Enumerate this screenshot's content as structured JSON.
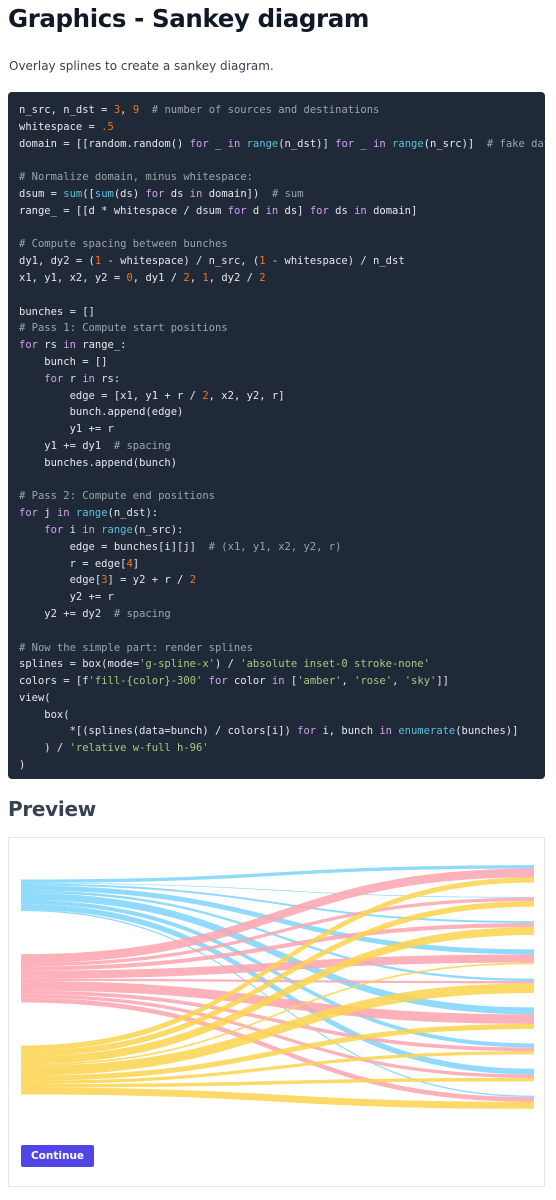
{
  "page": {
    "title": "Graphics - Sankey diagram",
    "subtitle": "Overlay splines to create a sankey diagram."
  },
  "code": {
    "lines": [
      [
        [
          "",
          "n_src, n_dst = "
        ],
        [
          "num",
          "3"
        ],
        [
          "",
          ", "
        ],
        [
          "num",
          "9"
        ],
        [
          "",
          "  "
        ],
        [
          "com",
          "# number of sources and destinations"
        ]
      ],
      [
        [
          "",
          "whitespace = "
        ],
        [
          "num",
          ".5"
        ]
      ],
      [
        [
          "",
          "domain = [[random.random() "
        ],
        [
          "kw",
          "for"
        ],
        [
          "",
          " _ "
        ],
        [
          "kw",
          "in"
        ],
        [
          "",
          " "
        ],
        [
          "fn",
          "range"
        ],
        [
          "",
          "(n_dst)] "
        ],
        [
          "kw",
          "for"
        ],
        [
          "",
          " _ "
        ],
        [
          "kw",
          "in"
        ],
        [
          "",
          " "
        ],
        [
          "fn",
          "range"
        ],
        [
          "",
          "(n_src)]  "
        ],
        [
          "com",
          "# fake data"
        ]
      ],
      [],
      [
        [
          "com",
          "# Normalize domain, minus whitespace:"
        ]
      ],
      [
        [
          "",
          "dsum = "
        ],
        [
          "fn",
          "sum"
        ],
        [
          "",
          "(["
        ],
        [
          "fn",
          "sum"
        ],
        [
          "",
          "(ds) "
        ],
        [
          "kw",
          "for"
        ],
        [
          "",
          " ds "
        ],
        [
          "kw",
          "in"
        ],
        [
          "",
          " domain])  "
        ],
        [
          "com",
          "# sum"
        ]
      ],
      [
        [
          "",
          "range_ = [[d * whitespace / dsum "
        ],
        [
          "kw",
          "for"
        ],
        [
          "",
          " d "
        ],
        [
          "kw",
          "in"
        ],
        [
          "",
          " ds] "
        ],
        [
          "kw",
          "for"
        ],
        [
          "",
          " ds "
        ],
        [
          "kw",
          "in"
        ],
        [
          "",
          " domain]"
        ]
      ],
      [],
      [
        [
          "com",
          "# Compute spacing between bunches"
        ]
      ],
      [
        [
          "",
          "dy1, dy2 = ("
        ],
        [
          "num",
          "1"
        ],
        [
          "",
          " - whitespace) / n_src, ("
        ],
        [
          "num",
          "1"
        ],
        [
          "",
          " - whitespace) / n_dst"
        ]
      ],
      [
        [
          "",
          "x1, y1, x2, y2 = "
        ],
        [
          "num",
          "0"
        ],
        [
          "",
          ", dy1 / "
        ],
        [
          "num",
          "2"
        ],
        [
          "",
          ", "
        ],
        [
          "num",
          "1"
        ],
        [
          "",
          ", dy2 / "
        ],
        [
          "num",
          "2"
        ]
      ],
      [],
      [
        [
          "",
          "bunches = []"
        ]
      ],
      [
        [
          "com",
          "# Pass 1: Compute start positions"
        ]
      ],
      [
        [
          "kw",
          "for"
        ],
        [
          "",
          " rs "
        ],
        [
          "kw",
          "in"
        ],
        [
          "",
          " range_:"
        ]
      ],
      [
        [
          "",
          "    bunch = []"
        ]
      ],
      [
        [
          "",
          "    "
        ],
        [
          "kw",
          "for"
        ],
        [
          "",
          " r "
        ],
        [
          "kw",
          "in"
        ],
        [
          "",
          " rs:"
        ]
      ],
      [
        [
          "",
          "        edge = [x1, y1 + r / "
        ],
        [
          "num",
          "2"
        ],
        [
          "",
          ", x2, y2, r]"
        ]
      ],
      [
        [
          "",
          "        bunch.append(edge)"
        ]
      ],
      [
        [
          "",
          "        y1 += r"
        ]
      ],
      [
        [
          "",
          "    y1 += dy1  "
        ],
        [
          "com",
          "# spacing"
        ]
      ],
      [
        [
          "",
          "    bunches.append(bunch)"
        ]
      ],
      [],
      [
        [
          "com",
          "# Pass 2: Compute end positions"
        ]
      ],
      [
        [
          "kw",
          "for"
        ],
        [
          "",
          " j "
        ],
        [
          "kw",
          "in"
        ],
        [
          "",
          " "
        ],
        [
          "fn",
          "range"
        ],
        [
          "",
          "(n_dst):"
        ]
      ],
      [
        [
          "",
          "    "
        ],
        [
          "kw",
          "for"
        ],
        [
          "",
          " i "
        ],
        [
          "kw",
          "in"
        ],
        [
          "",
          " "
        ],
        [
          "fn",
          "range"
        ],
        [
          "",
          "(n_src):"
        ]
      ],
      [
        [
          "",
          "        edge = bunches[i][j]  "
        ],
        [
          "com",
          "# (x1, y1, x2, y2, r)"
        ]
      ],
      [
        [
          "",
          "        r = edge["
        ],
        [
          "num",
          "4"
        ],
        [
          "",
          "]"
        ]
      ],
      [
        [
          "",
          "        edge["
        ],
        [
          "num",
          "3"
        ],
        [
          "",
          "] = y2 + r / "
        ],
        [
          "num",
          "2"
        ]
      ],
      [
        [
          "",
          "        y2 += r"
        ]
      ],
      [
        [
          "",
          "    y2 += dy2  "
        ],
        [
          "com",
          "# spacing"
        ]
      ],
      [],
      [
        [
          "com",
          "# Now the simple part: render splines"
        ]
      ],
      [
        [
          "",
          "splines = box(mode="
        ],
        [
          "str",
          "'g-spline-x'"
        ],
        [
          "",
          ") / "
        ],
        [
          "str",
          "'absolute inset-0 stroke-none'"
        ]
      ],
      [
        [
          "",
          "colors = [f"
        ],
        [
          "str",
          "'fill-{color}-300'"
        ],
        [
          "",
          " "
        ],
        [
          "kw",
          "for"
        ],
        [
          "",
          " color "
        ],
        [
          "kw",
          "in"
        ],
        [
          "",
          " ["
        ],
        [
          "str",
          "'amber'"
        ],
        [
          "",
          ", "
        ],
        [
          "str",
          "'rose'"
        ],
        [
          "",
          ", "
        ],
        [
          "str",
          "'sky'"
        ],
        [
          "",
          "]]"
        ]
      ],
      [
        [
          "",
          "view("
        ]
      ],
      [
        [
          "",
          "    box("
        ]
      ],
      [
        [
          "",
          "        *[(splines(data=bunch) / colors[i]) "
        ],
        [
          "kw",
          "for"
        ],
        [
          "",
          " i, bunch "
        ],
        [
          "kw",
          "in"
        ],
        [
          "",
          " "
        ],
        [
          "fn",
          "enumerate"
        ],
        [
          "",
          "(bunches)]"
        ]
      ],
      [
        [
          "",
          "    ) / "
        ],
        [
          "str",
          "'relative w-full h-96'"
        ]
      ],
      [
        [
          "",
          ")"
        ]
      ]
    ]
  },
  "preview": {
    "heading": "Preview",
    "continue_label": "Continue"
  },
  "chart_data": {
    "type": "sankey",
    "sources": [
      "sky",
      "rose",
      "amber"
    ],
    "destinations": 9,
    "whitespace": 0.5,
    "colors": {
      "sky": "#7dd3fc",
      "rose": "#fda4af",
      "amber": "#fcd34d"
    },
    "flows": [
      [
        0.29,
        0.06,
        0.17,
        0.43,
        0.21,
        0.6,
        0.35,
        0.49,
        0.12
      ],
      [
        0.76,
        0.29,
        0.36,
        0.7,
        0.2,
        0.82,
        0.32,
        0.29,
        0.41
      ],
      [
        0.45,
        0.49,
        0.67,
        0.15,
        0.83,
        0.44,
        0.28,
        0.3,
        0.6
      ]
    ]
  }
}
